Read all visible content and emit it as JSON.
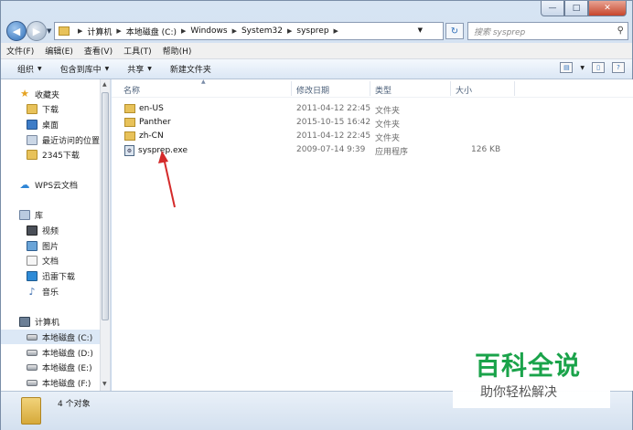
{
  "window": {
    "caption_buttons": {
      "minimize": "—",
      "maximize": "□",
      "close": "✕"
    }
  },
  "address_bar": {
    "crumbs": [
      "计算机",
      "本地磁盘 (C:)",
      "Windows",
      "System32",
      "sysprep"
    ],
    "search_placeholder": "搜索 sysprep"
  },
  "menu": [
    "文件(F)",
    "编辑(E)",
    "查看(V)",
    "工具(T)",
    "帮助(H)"
  ],
  "toolbar": {
    "organize": "组织",
    "include_in_library": "包含到库中",
    "share": "共享",
    "new_folder": "新建文件夹"
  },
  "nav": {
    "favorites": {
      "label": "收藏夹",
      "items": [
        "下载",
        "桌面",
        "最近访问的位置",
        "2345下载"
      ]
    },
    "wps": "WPS云文档",
    "libraries": {
      "label": "库",
      "items": [
        "视频",
        "图片",
        "文档",
        "迅雷下载",
        "音乐"
      ]
    },
    "computer": {
      "label": "计算机",
      "drives": [
        "本地磁盘 (C:)",
        "本地磁盘 (D:)",
        "本地磁盘 (E:)",
        "本地磁盘 (F:)"
      ]
    }
  },
  "columns": {
    "name": "名称",
    "date": "修改日期",
    "type": "类型",
    "size": "大小"
  },
  "files": [
    {
      "name": "en-US",
      "date": "2011-04-12 22:45",
      "type": "文件夹",
      "size": "",
      "icon": "folder-icon"
    },
    {
      "name": "Panther",
      "date": "2015-10-15 16:42",
      "type": "文件夹",
      "size": "",
      "icon": "folder-icon"
    },
    {
      "name": "zh-CN",
      "date": "2011-04-12 22:45",
      "type": "文件夹",
      "size": "",
      "icon": "folder-icon"
    },
    {
      "name": "sysprep.exe",
      "date": "2009-07-14 9:39",
      "type": "应用程序",
      "size": "126 KB",
      "icon": "exe-icon"
    }
  ],
  "status": {
    "count": "4 个对象"
  },
  "watermark": {
    "title": "百科全说",
    "subtitle": "助你轻松解决"
  },
  "colors": {
    "arrow": "#d42a2a",
    "watermark_green": "#1aa34a"
  }
}
